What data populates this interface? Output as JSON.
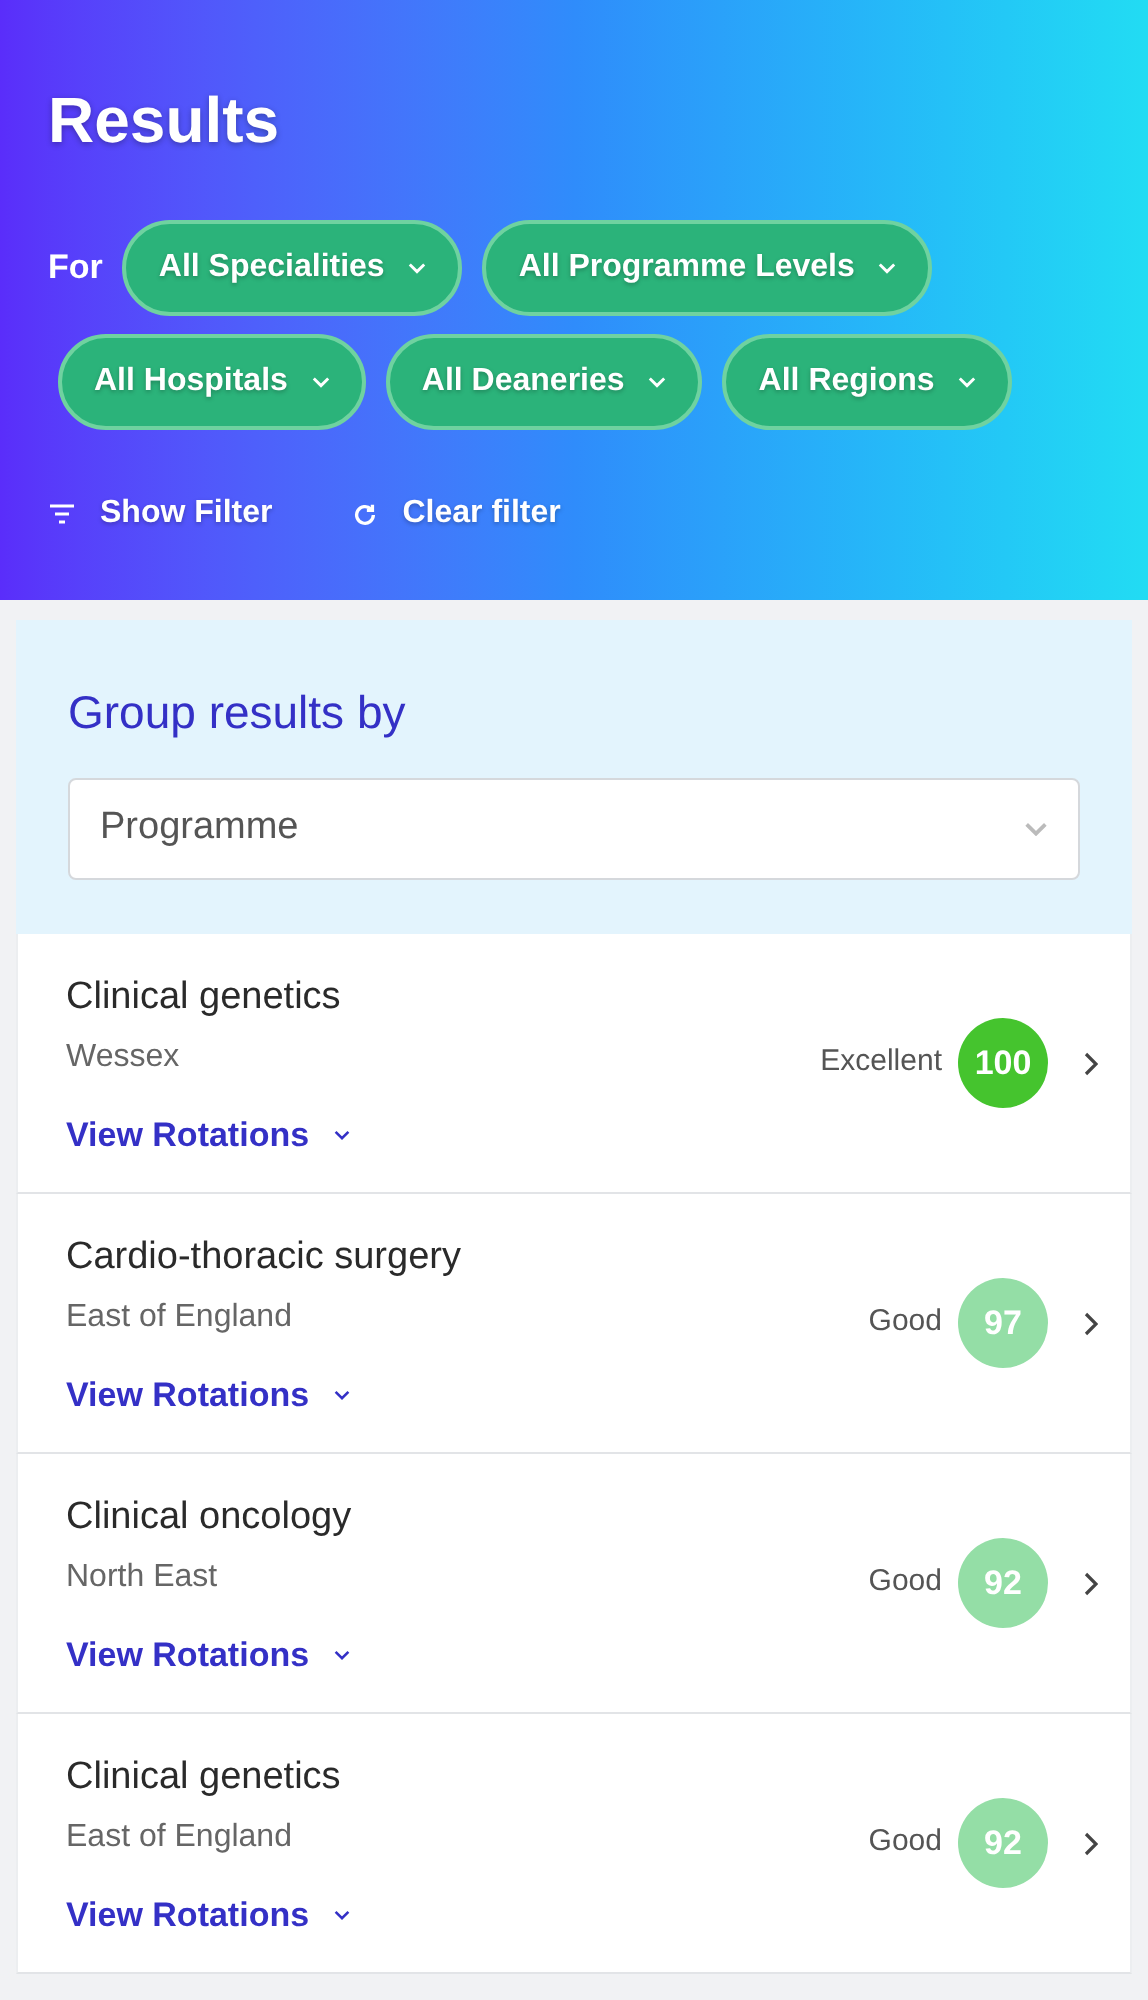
{
  "header": {
    "title": "Results",
    "for_label": "For",
    "filters": [
      "All Specialities",
      "All Programme Levels",
      "All Hospitals",
      "All Deaneries",
      "All Regions"
    ],
    "actions": [
      {
        "kind": "filter",
        "label": "Show Filter"
      },
      {
        "kind": "reset",
        "label": "Clear filter"
      }
    ]
  },
  "group_by": {
    "title": "Group results by",
    "value": "Programme"
  },
  "results": [
    {
      "name": "Clinical genetics",
      "region": "Wessex",
      "rating": "Excellent",
      "score": "100",
      "color": "#45c42e",
      "link": "View Rotations"
    },
    {
      "name": "Cardio-thoracic surgery",
      "region": "East of England",
      "rating": "Good",
      "score": "97",
      "color": "#94dea6",
      "link": "View Rotations"
    },
    {
      "name": "Clinical oncology",
      "region": "North East",
      "rating": "Good",
      "score": "92",
      "color": "#94dea6",
      "link": "View Rotations"
    },
    {
      "name": "Clinical genetics",
      "region": "East of England",
      "rating": "Good",
      "score": "92",
      "color": "#94dea6",
      "link": "View Rotations"
    }
  ]
}
